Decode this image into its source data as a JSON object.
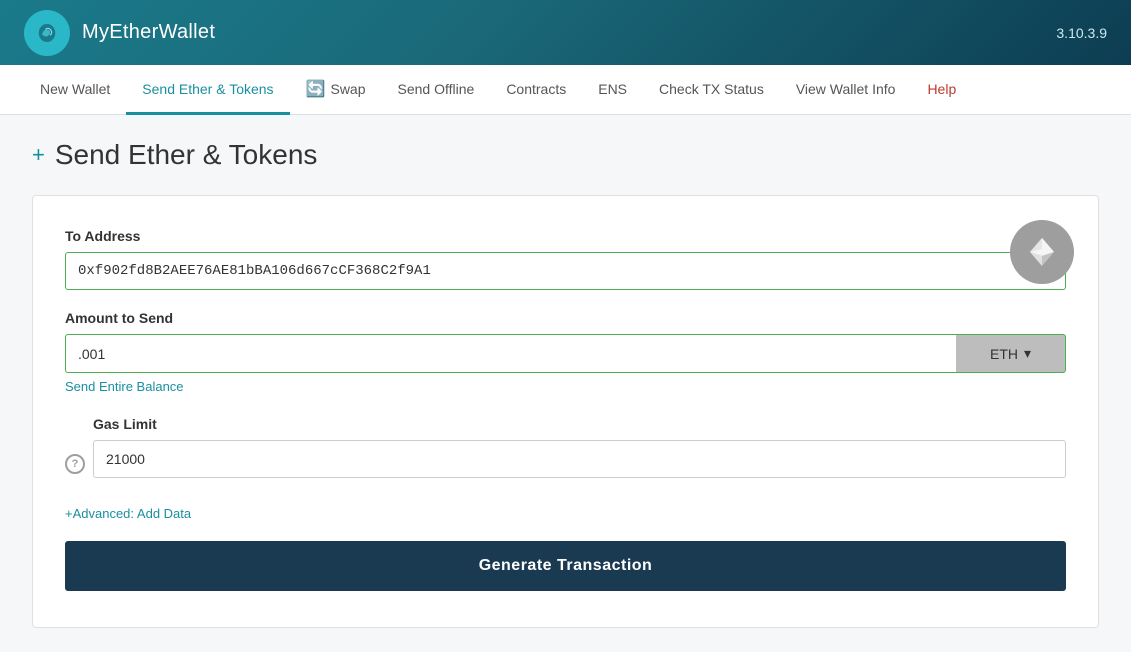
{
  "header": {
    "app_name": "MyEtherWallet",
    "version": "3.10.3.9"
  },
  "nav": {
    "items": [
      {
        "id": "new-wallet",
        "label": "New Wallet",
        "active": false,
        "help": false
      },
      {
        "id": "send-ether-tokens",
        "label": "Send Ether & Tokens",
        "active": true,
        "help": false
      },
      {
        "id": "swap",
        "label": "Swap",
        "active": false,
        "help": false,
        "has_icon": true
      },
      {
        "id": "send-offline",
        "label": "Send Offline",
        "active": false,
        "help": false
      },
      {
        "id": "contracts",
        "label": "Contracts",
        "active": false,
        "help": false
      },
      {
        "id": "ens",
        "label": "ENS",
        "active": false,
        "help": false
      },
      {
        "id": "check-tx-status",
        "label": "Check TX Status",
        "active": false,
        "help": false
      },
      {
        "id": "view-wallet-info",
        "label": "View Wallet Info",
        "active": false,
        "help": false
      },
      {
        "id": "help",
        "label": "Help",
        "active": false,
        "help": true
      }
    ]
  },
  "page": {
    "title": "Send Ether & Tokens",
    "plus_icon": "+"
  },
  "form": {
    "to_address_label": "To Address",
    "to_address_value": "0xf902fd8B2AEE76AE81bBA106d667cCF368C2f9A1",
    "to_address_placeholder": "0x...",
    "amount_label": "Amount to Send",
    "amount_value": ".001",
    "currency": "ETH",
    "currency_dropdown_arrow": "▾",
    "send_entire_balance": "Send Entire Balance",
    "gas_limit_label": "Gas Limit",
    "gas_limit_value": "21000",
    "advanced_link": "+Advanced: Add Data",
    "generate_btn": "Generate Transaction",
    "help_icon": "?"
  }
}
